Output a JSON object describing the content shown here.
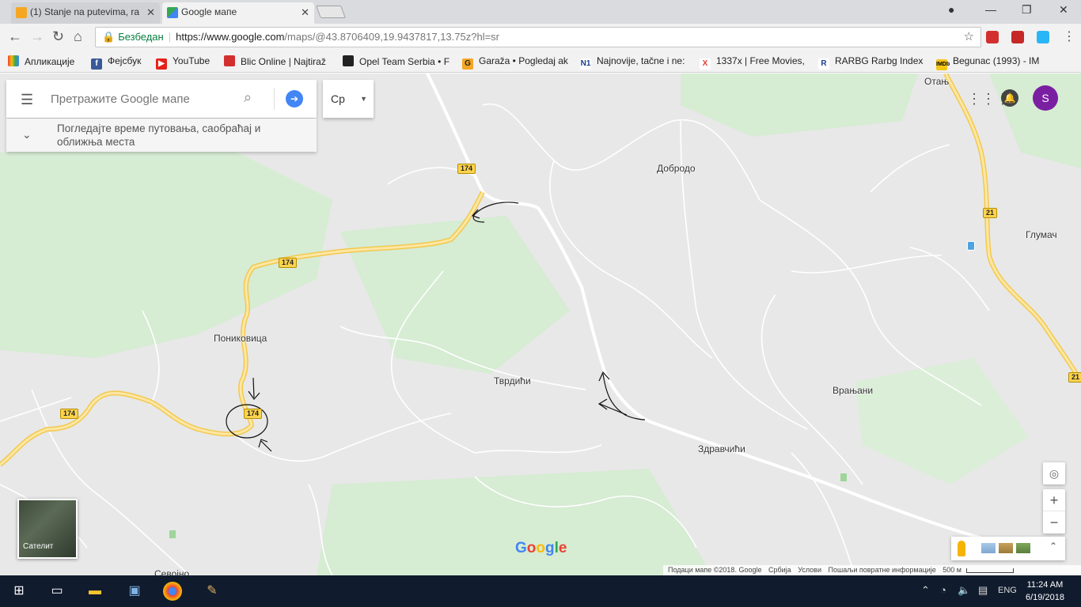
{
  "browser": {
    "tabs": [
      {
        "title": "(1) Stanje na putevima, ra",
        "active": false
      },
      {
        "title": "Google мапе",
        "active": true
      }
    ],
    "secure_label": "Безбедан",
    "url_host": "https://www.google.com",
    "url_rest": "/maps/@43.8706409,19.9437817,13.75z?hl=sr",
    "bookmarks": [
      "Апликације",
      "Фејсбук",
      "YouTube",
      "Blic Online | Najtiraž",
      "Opel Team Serbia • F",
      "Garaža • Pogledaj ak",
      "Najnovije, tačne i ne:",
      "1337x | Free Movies,",
      "RARBG Rarbg Index",
      "Begunac (1993) - IM"
    ]
  },
  "maps": {
    "search_placeholder": "Претражите Google мапе",
    "language": "Ср",
    "travel_hint": "Погледајте време путовања, саобраћај и оближња места",
    "user_initial": "S",
    "satellite_label": "Сателит",
    "logo": "Google",
    "places": [
      "Отањ",
      "Добродо",
      "Глумач",
      "Пониковица",
      "Тврдићи",
      "Врањани",
      "Здравчићи",
      "Севојно"
    ],
    "road_shields": [
      "174",
      "174",
      "174",
      "174",
      "21",
      "21"
    ],
    "footer": {
      "data": "Подаци мапе ©2018. Google",
      "country": "Србија",
      "terms": "Услови",
      "feedback": "Пошаљи повратне информације",
      "scale": "500 м"
    }
  },
  "taskbar": {
    "time": "11:24 AM",
    "date": "6/19/2018",
    "lang": "ENG"
  },
  "colors": {
    "highway": "#f8d46e",
    "road": "#ffffff",
    "map_bg": "#e8e8e8",
    "forest": "#d4ecd1",
    "accent_blue": "#4285f4"
  }
}
